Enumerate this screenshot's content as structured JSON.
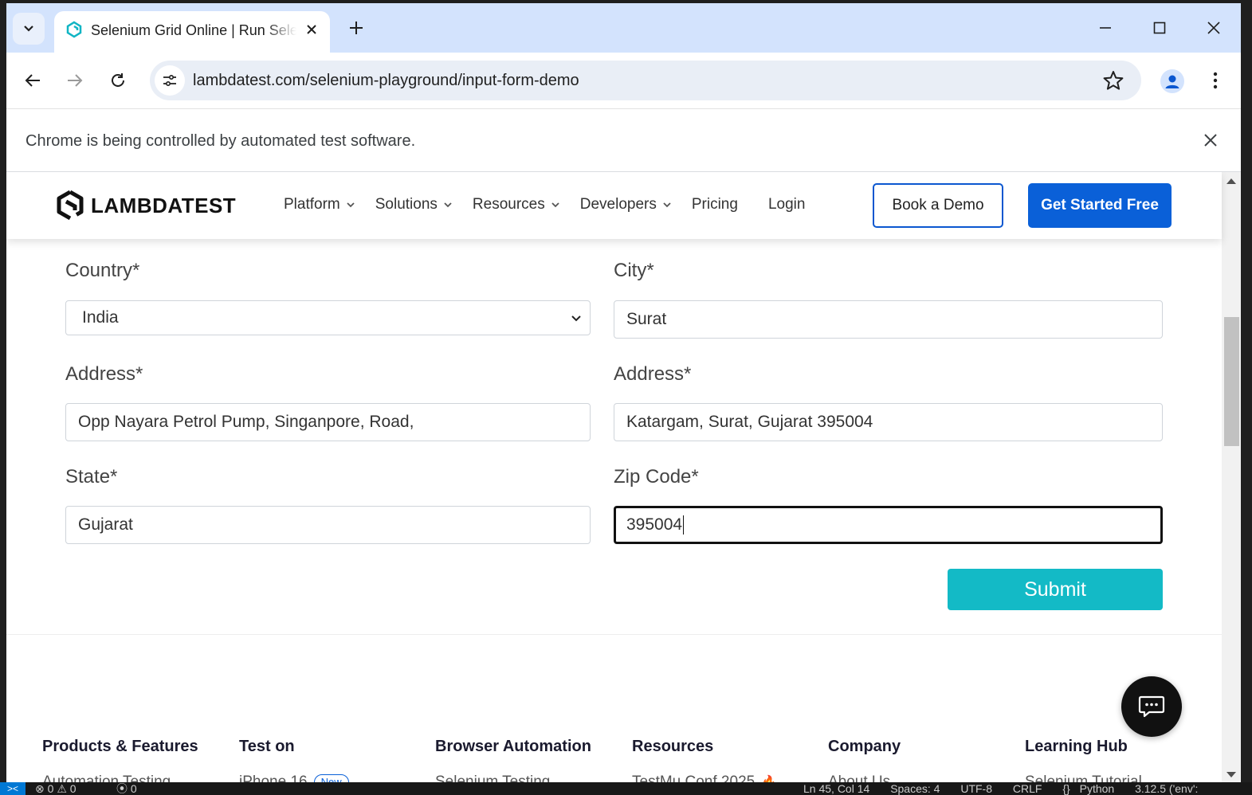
{
  "browser": {
    "tab_title": "Selenium Grid Online | Run Selenium Test Scripts",
    "url": "lambdatest.com/selenium-playground/input-form-demo",
    "infobar_message": "Chrome is being controlled by automated test software."
  },
  "header": {
    "logo_text": "LAMBDATEST",
    "menu": [
      {
        "label": "Platform",
        "dropdown": true
      },
      {
        "label": "Solutions",
        "dropdown": true
      },
      {
        "label": "Resources",
        "dropdown": true
      },
      {
        "label": "Developers",
        "dropdown": true
      },
      {
        "label": "Pricing",
        "dropdown": false
      },
      {
        "label": "Login",
        "dropdown": false
      }
    ],
    "book_demo": "Book a Demo",
    "get_started": "Get Started Free"
  },
  "form": {
    "country_label": "Country*",
    "country_value": "India",
    "city_label": "City*",
    "city_value": "Surat",
    "address1_label": "Address*",
    "address1_value": "Opp Nayara Petrol Pump, Singanpore, Road,",
    "address2_label": "Address*",
    "address2_value": "Katargam, Surat, Gujarat 395004",
    "state_label": "State*",
    "state_value": "Gujarat",
    "zip_label": "Zip Code*",
    "zip_value": "395004",
    "submit_label": "Submit"
  },
  "footer": {
    "columns": [
      {
        "heading": "Products & Features",
        "first_link": "Automation Testing"
      },
      {
        "heading": "Test on",
        "first_link": "iPhone 16",
        "badge": "New"
      },
      {
        "heading": "Browser Automation",
        "first_link": "Selenium Testing"
      },
      {
        "heading": "Resources",
        "first_link": "TestMu Conf 2025"
      },
      {
        "heading": "Company",
        "first_link": "About Us"
      },
      {
        "heading": "Learning Hub",
        "first_link": "Selenium Tutorial"
      }
    ]
  },
  "vscode_status": {
    "errors": "0",
    "warnings": "0",
    "ports": "0",
    "position": "Ln 45, Col 14",
    "spaces": "Spaces: 4",
    "encoding": "UTF-8",
    "eol": "CRLF",
    "language_braces": "{}",
    "language": "Python",
    "interpreter": "3.12.5 ('env':"
  },
  "colors": {
    "brand_blue": "#0a60d8",
    "submit_teal": "#13bac6",
    "tabstrip": "#d3e3fd"
  },
  "icons": [
    "tab-search-icon",
    "lambdatest-favicon",
    "close-icon",
    "plus-icon",
    "minimize-icon",
    "maximize-icon",
    "back-arrow-icon",
    "forward-arrow-icon",
    "reload-icon",
    "site-info-icon",
    "star-icon",
    "profile-icon",
    "kebab-menu-icon",
    "chevron-down-icon",
    "chat-icon"
  ]
}
